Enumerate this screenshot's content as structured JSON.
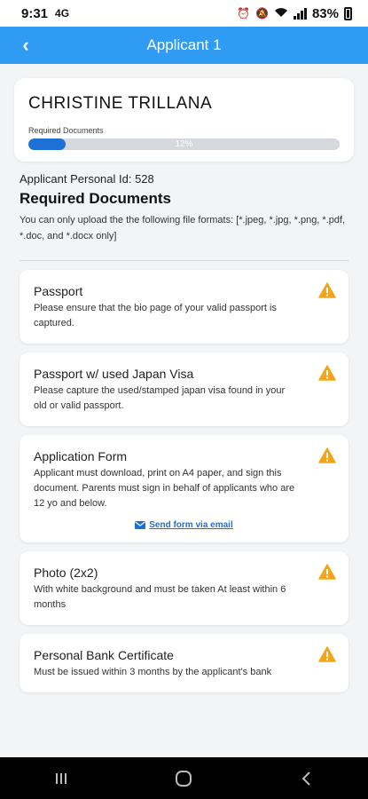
{
  "status_bar": {
    "time": "9:31",
    "left_icon": "4G",
    "battery_text": "83%"
  },
  "app_bar": {
    "back_icon": "chevron-left-icon",
    "title": "Applicant 1"
  },
  "applicant": {
    "name": "CHRISTINE TRILLANA",
    "progress_label": "Required Documents",
    "progress_text": "12%",
    "progress_value": 0.12,
    "progress_color": "#1e6fd6"
  },
  "info": {
    "personal_id": "Applicant Personal Id: 528",
    "section_title": "Required Documents",
    "formats": "You can only upload the the following file formats: [*.jpeg, *.jpg, *.png, *.pdf, *.doc, and *.docx only]"
  },
  "documents": [
    {
      "title": "Passport",
      "description": "Please ensure that the bio page of your valid passport is captured."
    },
    {
      "title": "Passport w/ used Japan Visa",
      "description": "Please capture the used/stamped japan visa found in your old or valid passport."
    },
    {
      "title": "Application Form",
      "description": "Applicant must download, print on A4 paper, and sign this document. Parents must sign in behalf of applicants who are 12 yo and below.",
      "link": "Send form via email"
    },
    {
      "title": "Photo (2x2)",
      "description": "With white background and must be taken At least within 6 months"
    },
    {
      "title": "Personal Bank Certificate",
      "description": "Must be issued within 3 months by the applicant's bank"
    }
  ],
  "icons": {
    "warning": "warning-icon",
    "mail": "mail-icon"
  },
  "colors": {
    "app_bar": "#2f9bf2",
    "warning": "#f2a51a",
    "link": "#1e6fd6"
  }
}
